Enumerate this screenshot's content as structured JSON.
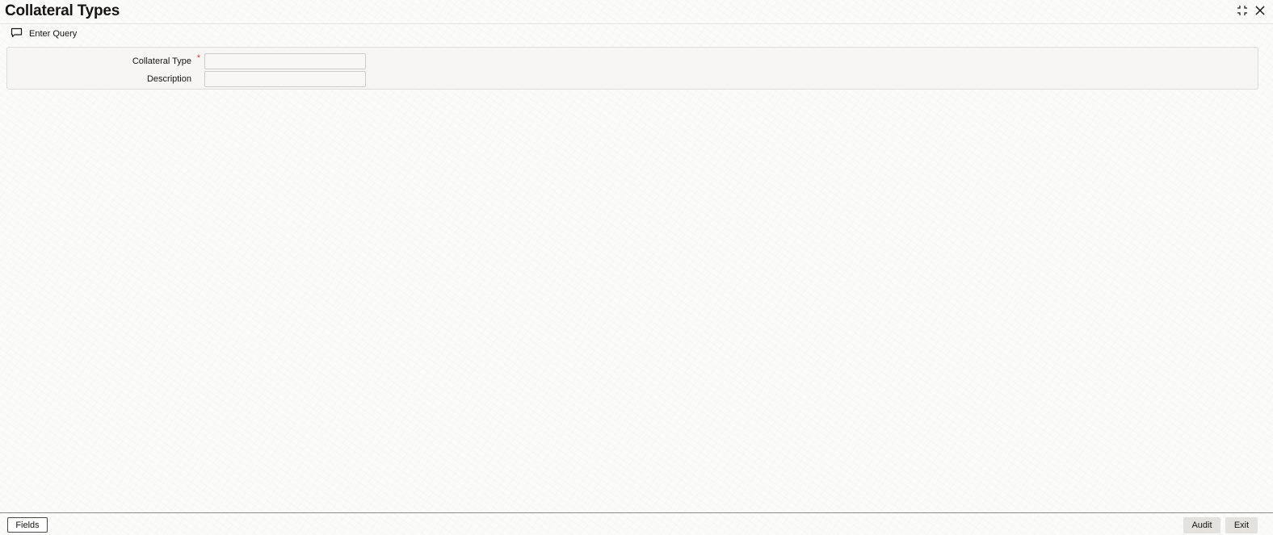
{
  "window": {
    "title": "Collateral Types",
    "controls": [
      {
        "name": "collapse-icon",
        "glyph": "collapse"
      },
      {
        "name": "close-icon",
        "glyph": "close"
      }
    ]
  },
  "toolbar": {
    "enter_query_label": "Enter Query",
    "enter_query_icon": "comment-icon"
  },
  "form": {
    "collateral_type": {
      "label": "Collateral Type",
      "required_marker": "*",
      "value": ""
    },
    "description": {
      "label": "Description",
      "value": ""
    }
  },
  "footer": {
    "fields_label": "Fields",
    "audit_label": "Audit",
    "exit_label": "Exit"
  },
  "colors": {
    "required": "#c74634",
    "text": "#161513",
    "footer_button_bg": "#e4e2de"
  }
}
